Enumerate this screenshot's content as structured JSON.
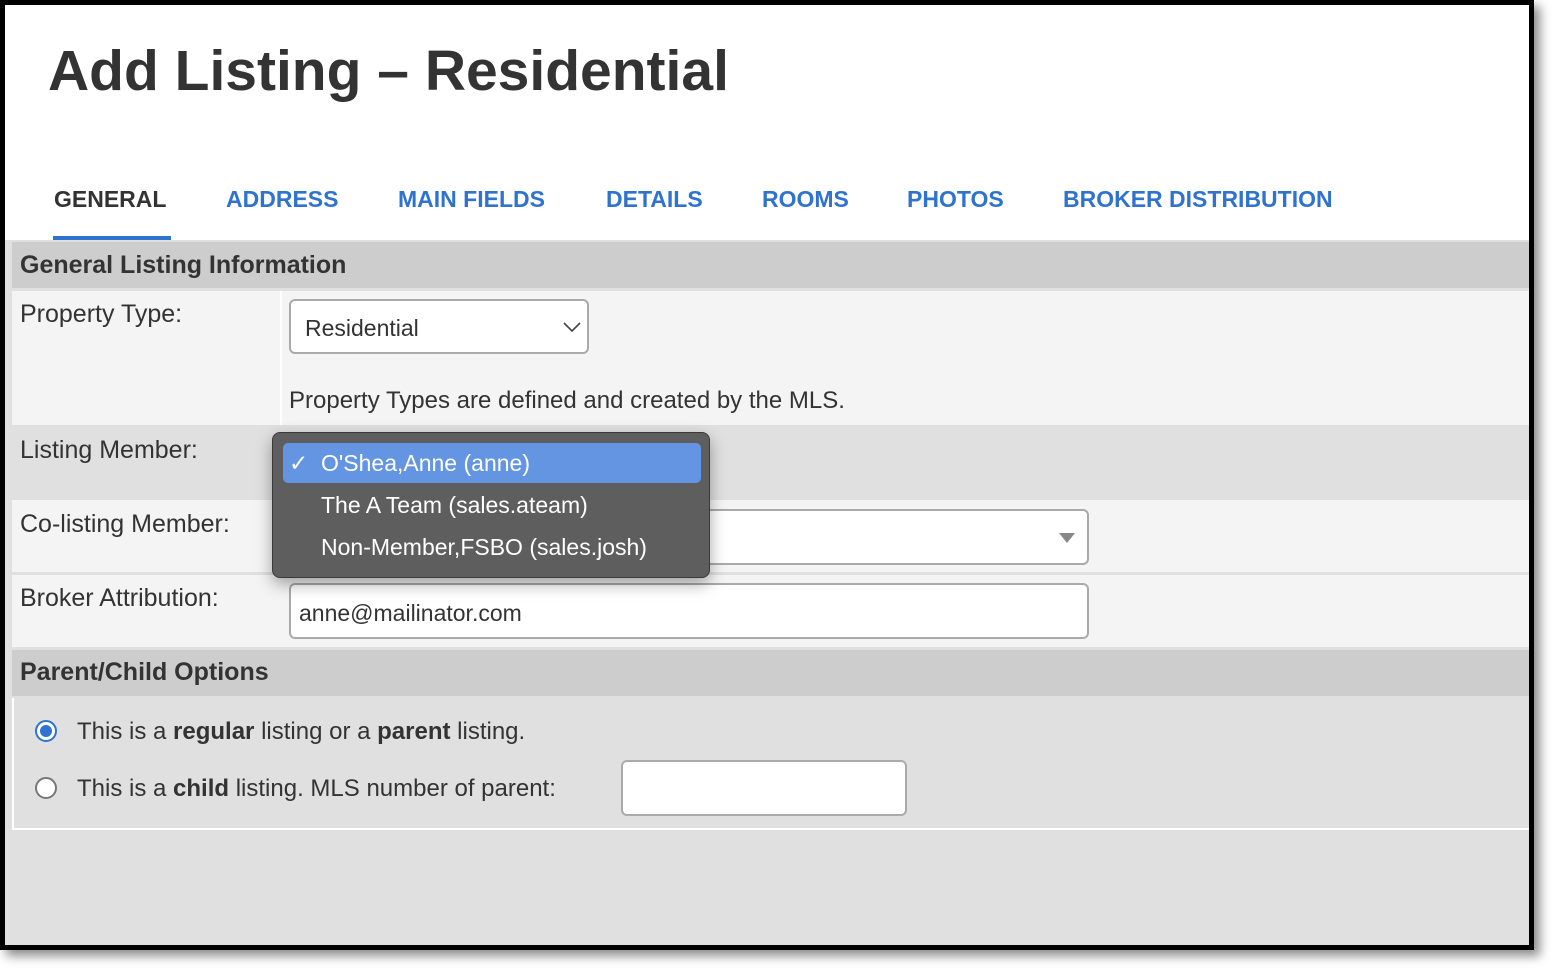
{
  "page": {
    "title": "Add Listing – Residential"
  },
  "tabs": [
    {
      "label": "GENERAL",
      "active": true
    },
    {
      "label": "ADDRESS"
    },
    {
      "label": "MAIN FIELDS"
    },
    {
      "label": "DETAILS"
    },
    {
      "label": "ROOMS"
    },
    {
      "label": "PHOTOS"
    },
    {
      "label": "BROKER DISTRIBUTION"
    }
  ],
  "general": {
    "section_title": "General Listing Information",
    "property_type": {
      "label": "Property Type:",
      "value": "Residential",
      "help": "Property Types are defined and created by the MLS."
    },
    "listing_member": {
      "label": "Listing Member:",
      "options": [
        {
          "label": "O'Shea,Anne (anne)",
          "selected": true
        },
        {
          "label": "The A Team (sales.ateam)"
        },
        {
          "label": "Non-Member,FSBO (sales.josh)"
        }
      ],
      "check": "✓"
    },
    "co_listing_member": {
      "label": "Co-listing Member:",
      "value": ""
    },
    "broker_attribution": {
      "label": "Broker Attribution:",
      "value": "anne@mailinator.com"
    }
  },
  "parent_child": {
    "section_title": "Parent/Child Options",
    "regular": {
      "selected": true,
      "parts": [
        "This is a ",
        "regular",
        " listing or a ",
        "parent",
        " listing."
      ]
    },
    "child": {
      "selected": false,
      "parts": [
        "This is a ",
        "child",
        " listing.",
        "MLS number of parent:"
      ],
      "mls_value": ""
    }
  },
  "colors": {
    "accent": "#2f73cf",
    "selected_option": "#6495e2",
    "section_bar": "#cdcdcd"
  }
}
